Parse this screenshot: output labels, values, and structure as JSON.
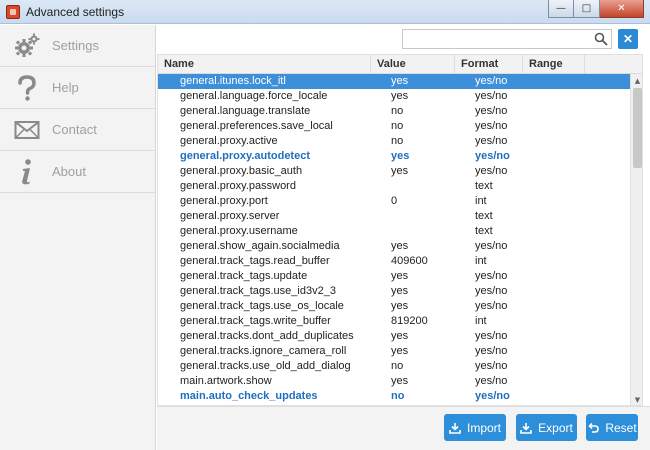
{
  "window": {
    "title": "Advanced settings"
  },
  "sidebar": {
    "items": [
      {
        "label": "Settings",
        "icon": "gear-icon"
      },
      {
        "label": "Help",
        "icon": "question-icon"
      },
      {
        "label": "Contact",
        "icon": "envelope-icon"
      },
      {
        "label": "About",
        "icon": "info-icon"
      }
    ]
  },
  "search": {
    "value": "",
    "placeholder": ""
  },
  "table": {
    "columns": [
      "Name",
      "Value",
      "Format",
      "Range"
    ],
    "rows": [
      {
        "name": "general.itunes.lock_itl",
        "value": "yes",
        "format": "yes/no",
        "range": ""
      },
      {
        "name": "general.language.force_locale",
        "value": "yes",
        "format": "yes/no",
        "range": ""
      },
      {
        "name": "general.language.translate",
        "value": "no",
        "format": "yes/no",
        "range": ""
      },
      {
        "name": "general.preferences.save_local",
        "value": "no",
        "format": "yes/no",
        "range": ""
      },
      {
        "name": "general.proxy.active",
        "value": "no",
        "format": "yes/no",
        "range": ""
      },
      {
        "name": "general.proxy.autodetect",
        "value": "yes",
        "format": "yes/no",
        "range": ""
      },
      {
        "name": "general.proxy.basic_auth",
        "value": "yes",
        "format": "yes/no",
        "range": ""
      },
      {
        "name": "general.proxy.password",
        "value": "",
        "format": "text",
        "range": ""
      },
      {
        "name": "general.proxy.port",
        "value": "0",
        "format": "int",
        "range": ""
      },
      {
        "name": "general.proxy.server",
        "value": "",
        "format": "text",
        "range": ""
      },
      {
        "name": "general.proxy.username",
        "value": "",
        "format": "text",
        "range": ""
      },
      {
        "name": "general.show_again.socialmedia",
        "value": "yes",
        "format": "yes/no",
        "range": ""
      },
      {
        "name": "general.track_tags.read_buffer",
        "value": "409600",
        "format": "int",
        "range": ""
      },
      {
        "name": "general.track_tags.update",
        "value": "yes",
        "format": "yes/no",
        "range": ""
      },
      {
        "name": "general.track_tags.use_id3v2_3",
        "value": "yes",
        "format": "yes/no",
        "range": ""
      },
      {
        "name": "general.track_tags.use_os_locale",
        "value": "yes",
        "format": "yes/no",
        "range": ""
      },
      {
        "name": "general.track_tags.write_buffer",
        "value": "819200",
        "format": "int",
        "range": ""
      },
      {
        "name": "general.tracks.dont_add_duplicates",
        "value": "yes",
        "format": "yes/no",
        "range": ""
      },
      {
        "name": "general.tracks.ignore_camera_roll",
        "value": "yes",
        "format": "yes/no",
        "range": ""
      },
      {
        "name": "general.tracks.use_old_add_dialog",
        "value": "no",
        "format": "yes/no",
        "range": ""
      },
      {
        "name": "main.artwork.show",
        "value": "yes",
        "format": "yes/no",
        "range": ""
      },
      {
        "name": "main.auto_check_updates",
        "value": "no",
        "format": "yes/no",
        "range": ""
      }
    ]
  },
  "footer": {
    "import_label": "Import",
    "export_label": "Export",
    "reset_label": "Reset"
  },
  "colors": {
    "accent": "#2d8fda",
    "selected_row": "#3c8fd8",
    "modified_text": "#1f6fbf"
  }
}
